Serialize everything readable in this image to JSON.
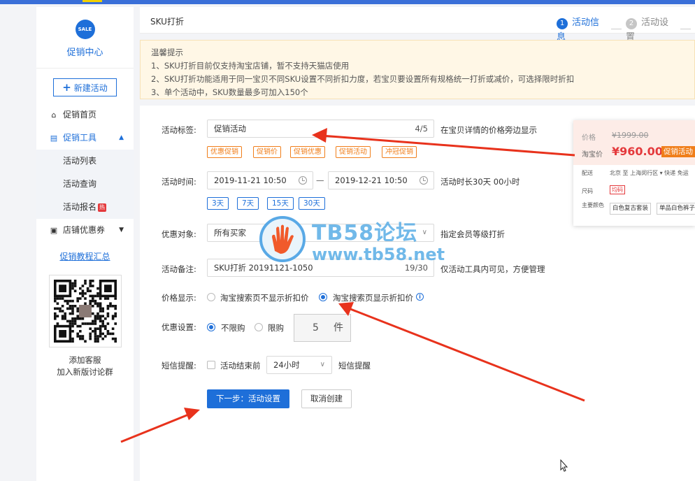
{
  "sidebar": {
    "logo_badge": "SALE",
    "title": "促销中心",
    "new_button": "新建活动",
    "items": [
      {
        "label": "促销首页",
        "icon": "home-icon"
      },
      {
        "label": "促销工具",
        "icon": "tool-icon"
      },
      {
        "label": "店铺优惠券",
        "icon": "coupon-icon"
      }
    ],
    "sub_items": [
      "活动列表",
      "活动查询",
      "活动报名"
    ],
    "hot_badge": "热",
    "tutorial_link": "促销教程汇总",
    "qr_caption_1": "添加客服",
    "qr_caption_2": "加入新版讨论群"
  },
  "header": {
    "title": "SKU打折",
    "steps": [
      {
        "num": "1",
        "label": "活动信息"
      },
      {
        "num": "2",
        "label": "活动设置"
      }
    ]
  },
  "notice": {
    "title": "温馨提示",
    "lines": [
      "1、SKU打折目前仅支持淘宝店铺，暂不支持天猫店使用",
      "2、SKU打折功能适用于同一宝贝不同SKU设置不同折扣力度，若宝贝要设置所有规格统一打折或减价，可选择限时折扣",
      "3、单个活动中，SKU数量最多可加入150个"
    ]
  },
  "form": {
    "tag_label": "活动标签:",
    "tag_value": "促销活动",
    "tag_count": "4/5",
    "tag_hint": "在宝贝详情的价格旁边显示",
    "tag_options": [
      "优惠促销",
      "促销价",
      "促销优惠",
      "促销活动",
      "冲冠促销"
    ],
    "time_label": "活动时间:",
    "start": "2019-11-21 10:50",
    "end": "2019-12-21 10:50",
    "time_sep": "—",
    "duration": "活动时长30天 00小时",
    "day_options": [
      "3天",
      "7天",
      "15天",
      "30天"
    ],
    "target_label": "优惠对象:",
    "target_value": "所有买家",
    "target_hint": "指定会员等级打折",
    "remark_label": "活动备注:",
    "remark_value": "SKU打折 20191121-1050",
    "remark_count": "19/30",
    "remark_hint": "仅活动工具内可见，方便管理",
    "price_label": "价格显示:",
    "price_opt1": "淘宝搜索页不显示折扣价",
    "price_opt2": "淘宝搜索页显示折扣价",
    "limit_label": "优惠设置:",
    "limit_opt1": "不限购",
    "limit_opt2": "限购",
    "limit_num": "5",
    "limit_unit": "件",
    "sms_label": "短信提醒:",
    "sms_check": "活动结束前",
    "sms_select": "24小时",
    "sms_hint": "短信提醒",
    "next_button": "下一步：活动设置",
    "cancel_button": "取消创建"
  },
  "preview": {
    "price_label": "价格",
    "old_price": "¥1999.00",
    "tb_label": "淘宝价",
    "new_price": "¥960.00",
    "badge": "促销活动",
    "ship_label": "配送",
    "ship_value": "北京 至 上海闵行区 ▾ 快递 免运",
    "size_label": "尺码",
    "size_value": "均码",
    "color_label": "主要颜色",
    "color_1": "白色复古套装",
    "color_2": "单品白色裤子"
  },
  "watermark": {
    "line1": "TB58论坛",
    "line2": "www.tb58.net"
  },
  "colors": {
    "accent": "#1e6fd9",
    "tag": "#f07e1a",
    "arrow": "#e8321c"
  }
}
